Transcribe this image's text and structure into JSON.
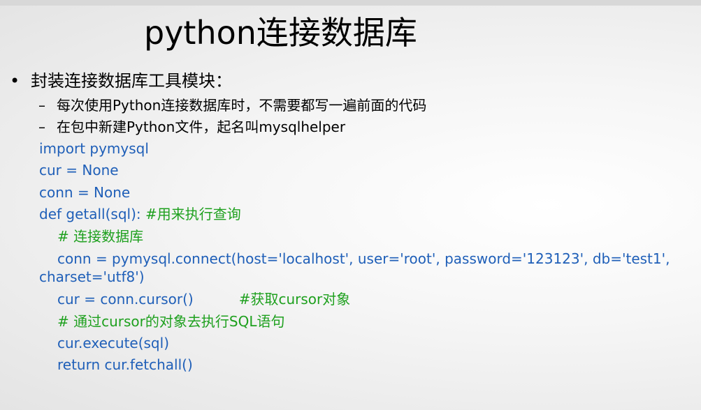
{
  "slide": {
    "title": "python连接数据库",
    "bullet": "封装连接数据库工具模块：",
    "sub_items": [
      "每次使用Python连接数据库时，不需要都写一遍前面的代码",
      "在包中新建Python文件，起名叫mysqlhelper"
    ],
    "code": {
      "line1": "import pymysql",
      "line2": "cur = None",
      "line3": "conn = None",
      "line4_code": "def getall(sql): ",
      "line4_comment": "#用来执行查询",
      "line5_comment": "# 连接数据库",
      "line6": "conn = pymysql.connect(host='localhost', user='root', password='123123', db='test1',",
      "line7": "charset='utf8')",
      "line8_code": "cur = conn.cursor()",
      "line8_comment": "#获取cursor对象",
      "line9_comment": "# 通过cursor的对象去执行SQL语句",
      "line10": "cur.execute(sql)",
      "line11": "return cur.fetchall()"
    }
  },
  "colors": {
    "code": "#1f5fb8",
    "comment": "#1ea01e",
    "text": "#000000"
  }
}
